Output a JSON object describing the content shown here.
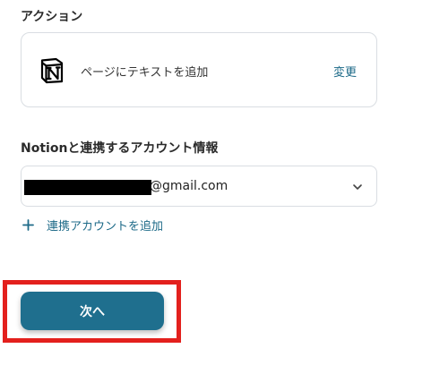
{
  "action_section": {
    "label": "アクション",
    "card": {
      "icon": "notion-logo-icon",
      "action_name": "ページにテキストを追加",
      "change_label": "変更"
    }
  },
  "account_section": {
    "label": "Notionと連携するアカウント情報",
    "selected_account": {
      "email_suffix": "@gmail.com",
      "redacted": true
    },
    "chevron_icon": "chevron-down-icon",
    "add_account_label": "連携アカウントを追加",
    "add_icon": "plus-icon"
  },
  "footer": {
    "next_label": "次へ",
    "highlight_color": "#e3201d"
  },
  "colors": {
    "accent": "#1d6a88",
    "button_bg": "#1f6f8e",
    "border": "#d9dde2",
    "highlight": "#e3201d"
  }
}
